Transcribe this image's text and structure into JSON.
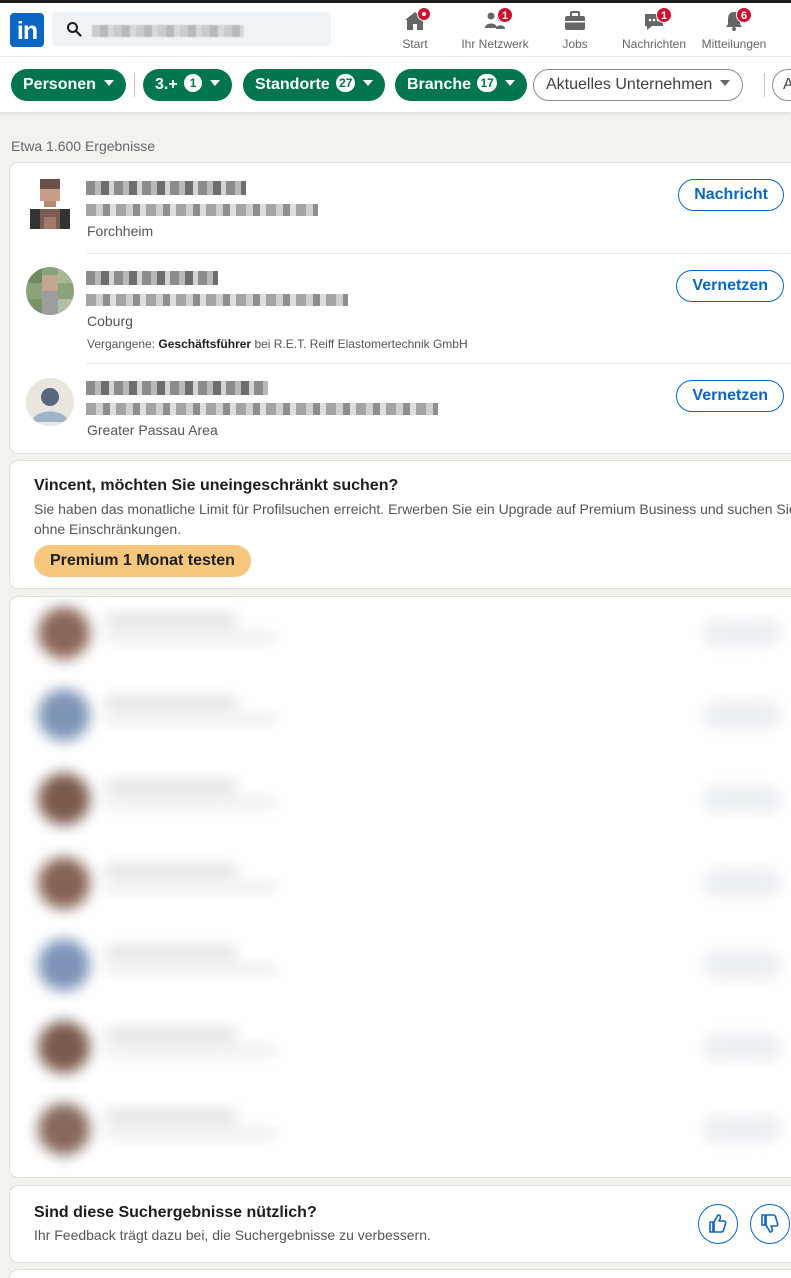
{
  "nav": {
    "logo": "in",
    "items": [
      {
        "label": "Start",
        "badge": ""
      },
      {
        "label": "Ihr Netzwerk",
        "badge": "1"
      },
      {
        "label": "Jobs",
        "badge": ""
      },
      {
        "label": "Nachrichten",
        "badge": "1"
      },
      {
        "label": "Mitteilungen",
        "badge": "6"
      }
    ]
  },
  "filters": {
    "personen": "Personen",
    "degree": "3.+",
    "degree_count": "1",
    "standorte": "Standorte",
    "standorte_count": "27",
    "branche": "Branche",
    "branche_count": "17",
    "unternehmen": "Aktuelles Unternehmen",
    "more": "A"
  },
  "results": {
    "count": "Etwa 1.600 Ergebnisse",
    "items": [
      {
        "location": "Forchheim",
        "action": "Nachricht"
      },
      {
        "location": "Coburg",
        "action": "Vernetzen",
        "past_prefix": "Vergangene:",
        "past_role": "Geschäftsführer",
        "past_rest": "bei R.E.T. Reiff Elastomertechnik GmbH"
      },
      {
        "location": "Greater Passau Area",
        "action": "Vernetzen"
      }
    ]
  },
  "premium": {
    "title": "Vincent, möchten Sie uneingeschränkt suchen?",
    "text": "Sie haben das monatliche Limit für Profilsuchen erreicht. Erwerben Sie ein Upgrade auf Premium Business und suchen Sie ohne Einschränkungen.",
    "button": "Premium 1 Monat testen"
  },
  "feedback": {
    "title": "Sind diese Suchergebnisse nützlich?",
    "text": "Ihr Feedback trägt dazu bei, die Suchergebnisse zu verbessern."
  },
  "colors": {
    "brand": "#0a66c2",
    "filter_active": "#01754f",
    "premium": "#f8c77e",
    "badge": "#cb112d"
  }
}
